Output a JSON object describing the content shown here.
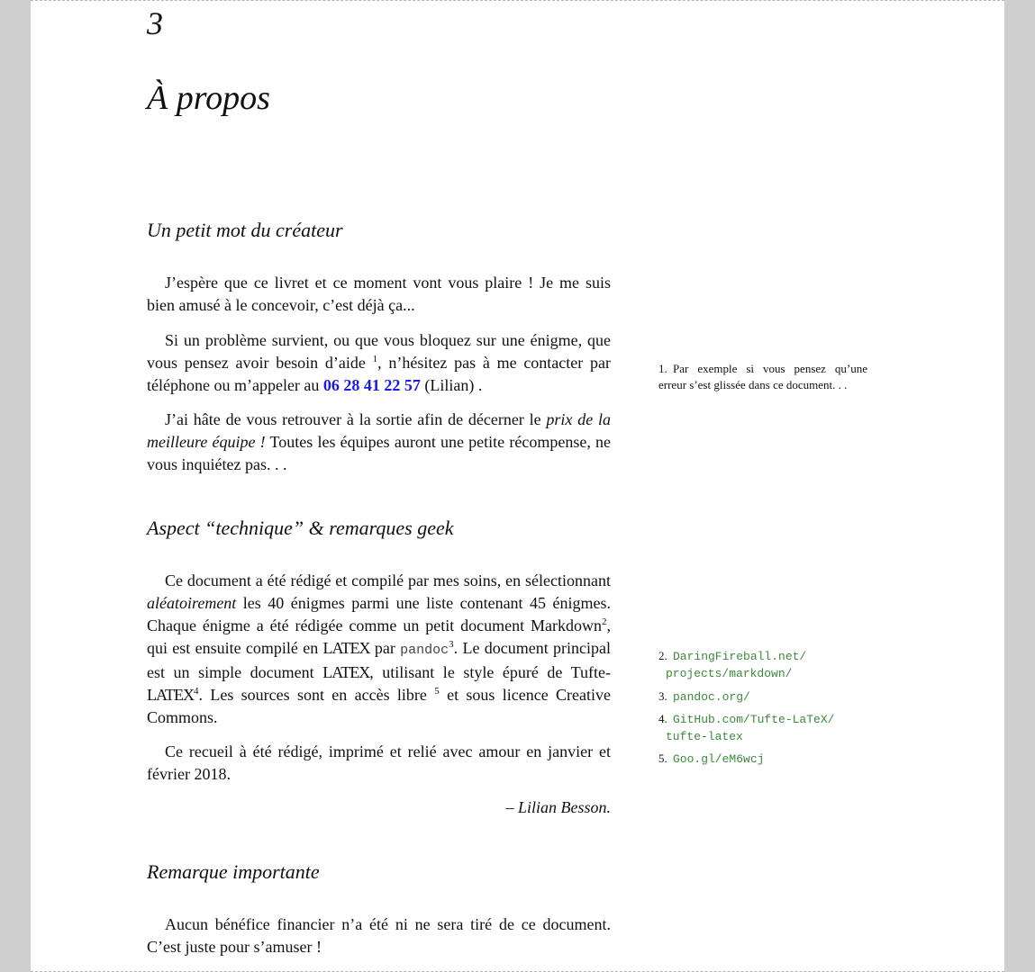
{
  "chapter": {
    "number": "3",
    "title": "À propos"
  },
  "sections": {
    "createur": {
      "heading": "Un petit mot du créateur",
      "p1": "J’espère que ce livret et ce moment vont vous plaire ! Je me suis bien amusé à le concevoir, c’est déjà ça...",
      "p2_a": "Si un problème survient, ou que vous bloquez sur une énigme, que vous pensez avoir besoin d’aide",
      "p2_fn": "1",
      "p2_b": ", n’hésitez pas à me contacter par téléphone ou m’appeler au",
      "p2_phone": "06 28 41 22 57",
      "p2_c": "(Lilian) .",
      "p3_a": "J’ai hâte de vous retrouver à la sortie afin de décerner le",
      "p3_em": "prix de la meilleure équipe !",
      "p3_b": "Toutes les équipes auront une petite récompense, ne vous inquiétez pas. . ."
    },
    "technique": {
      "heading": "Aspect “technique” & remarques geek",
      "p1_a": "Ce document a été rédigé et compilé par mes soins, en sélectionnant",
      "p1_em": "aléatoirement",
      "p1_b": "les 40 énigmes parmi une liste contenant 45 énigmes. Chaque énigme a été rédigée comme un petit document Markdown",
      "fn2": "2",
      "p1_c": ", qui est ensuite compilé en",
      "latex": "LATEX",
      "p1_d": "par",
      "pandoc": "pandoc",
      "fn3": "3",
      "p1_e": ". Le document principal est un simple document",
      "p1_f": ", utilisant le style épuré de Tufte-",
      "fn4": "4",
      "p1_g": ". Les sources sont en accès libre",
      "fn5": "5",
      "p1_h": "et sous licence Creative Commons.",
      "p2": "Ce recueil à été rédigé, imprimé et relié avec amour en janvier et février 2018.",
      "signature": "– Lilian Besson."
    },
    "remarque": {
      "heading": "Remarque importante",
      "p1": "Aucun bénéfice financier n’a été ni ne sera tiré de ce document. C’est juste pour s’amuser !"
    }
  },
  "sidenotes": [
    {
      "num": "1.",
      "text": "Par exemple si vous pensez qu’une erreur s’est glissée dans ce document. . ."
    },
    {
      "num": "2.",
      "line1": "DaringFireball.net/",
      "line2": "projects/markdown/"
    },
    {
      "num": "3.",
      "line1": "pandoc.org/"
    },
    {
      "num": "4.",
      "line1": "GitHub.com/Tufte-LaTeX/",
      "line2": "tufte-latex"
    },
    {
      "num": "5.",
      "line1": "Goo.gl/eM6wcj"
    }
  ]
}
